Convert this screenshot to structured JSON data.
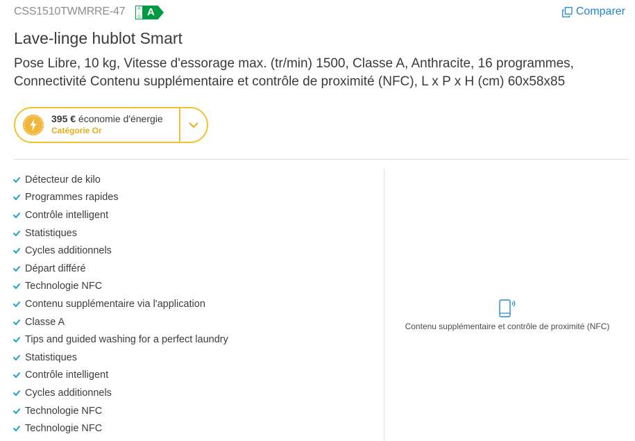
{
  "header": {
    "model": "CSS1510TWMRRE-47",
    "energy_scale": [
      "A",
      "↑",
      "G"
    ],
    "energy_class": "A",
    "compare_label": "Comparer"
  },
  "product": {
    "title": "Lave-linge hublot Smart",
    "description": "Pose Libre, 10 kg, Vitesse d'essorage max. (tr/min) 1500, Classe A, Anthracite, 16 programmes, Connectivité Contenu supplémentaire et contrôle de proximité (NFC), L x P x H (cm) 60x58x85"
  },
  "energy_saving": {
    "amount": "395 €",
    "label": " économie d'énergie",
    "category": "Catégorie Or"
  },
  "features": [
    "Détecteur de kilo",
    "Programmes rapides",
    "Contrôle intelligent",
    "Statistiques",
    "Cycles additionnels",
    "Départ différé",
    "Technologie NFC",
    "Contenu supplémentaire via l'application",
    "Classe A",
    "Tips and guided washing for a perfect laundry",
    "Statistiques",
    "Contrôle intelligent",
    "Cycles additionnels",
    "Technologie NFC",
    "Technologie NFC"
  ],
  "feature_icon": "check-icon",
  "connectivity": {
    "icon": "smartphone-nfc-icon",
    "label": "Contenu supplémentaire et contrôle de proximité (NFC)"
  },
  "colors": {
    "accent_blue": "#1f87c9",
    "energy_green": "#009a44",
    "gold": "#f2c12e",
    "check": "#1aa0c9"
  }
}
